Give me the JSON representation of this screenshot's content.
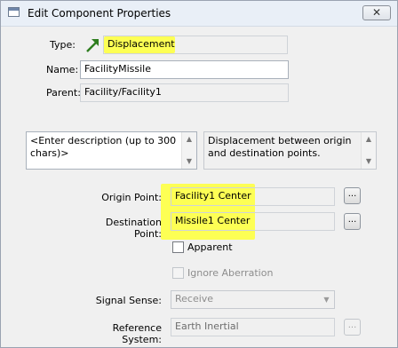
{
  "window": {
    "title": "Edit Component Properties",
    "close_glyph": "✕"
  },
  "type": {
    "label": "Type:",
    "value": "Displacement",
    "icon": "arrow-up-right-icon"
  },
  "name": {
    "label": "Name:",
    "value": "FacilityMissile"
  },
  "parent": {
    "label": "Parent:",
    "value": "Facility/Facility1"
  },
  "description": {
    "placeholder_text": "<Enter description (up to 300 chars)>"
  },
  "summary": {
    "text": "Displacement between origin and destination points."
  },
  "origin": {
    "label": "Origin Point:",
    "value": "Facility1 Center",
    "browse": "..."
  },
  "destination": {
    "label": "Destination Point:",
    "value": "Missile1 Center",
    "browse": "..."
  },
  "apparent": {
    "label": "Apparent",
    "checked": false
  },
  "ignore_aberration": {
    "label": "Ignore Aberration",
    "checked": false
  },
  "signal_sense": {
    "label": "Signal Sense:",
    "value": "Receive"
  },
  "reference_system": {
    "label": "Reference System:",
    "value": "Earth Inertial",
    "browse": "..."
  },
  "colors": {
    "highlight": "#fdff54",
    "title_bar": "#e9eff7",
    "arrow": "#2e7d1f"
  }
}
